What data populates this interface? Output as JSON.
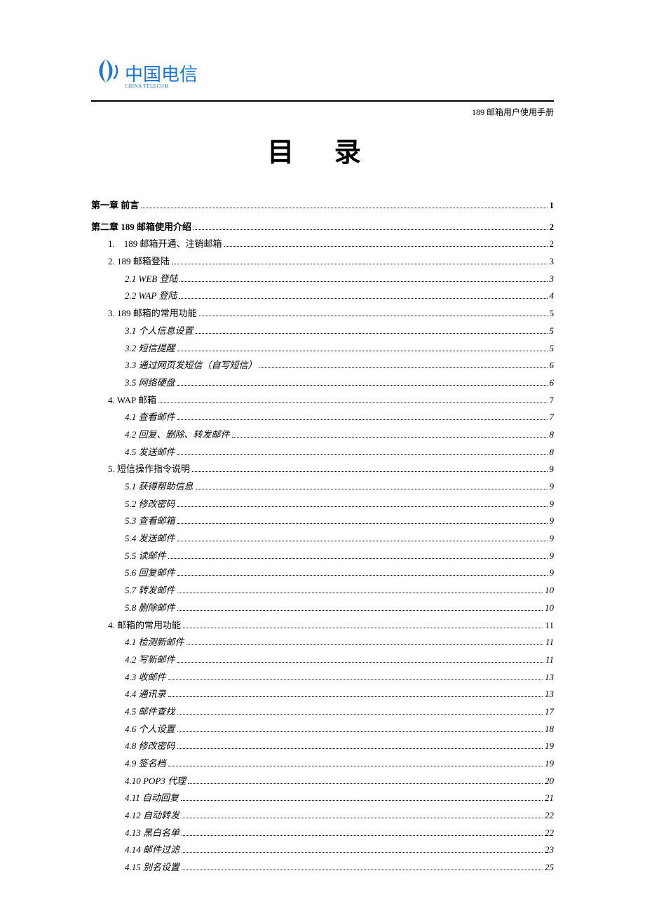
{
  "brand": {
    "name": "中国电信",
    "sub": "CHINA TELECOM"
  },
  "header_right": "189 邮箱用户使用手册",
  "title": "目  录",
  "toc": [
    {
      "level": 0,
      "label": "第一章  前言",
      "page": "1"
    },
    {
      "level": 0,
      "label": "第二章  189 邮箱使用介绍",
      "page": "2"
    },
    {
      "level": 1,
      "label": "1.　189 邮箱开通、注销邮箱",
      "page": "2"
    },
    {
      "level": 1,
      "label": "2. 189 邮箱登陆",
      "page": "3"
    },
    {
      "level": 2,
      "label": "2.1 WEB 登陆",
      "page": "3"
    },
    {
      "level": 2,
      "label": "2.2 WAP 登陆",
      "page": "4"
    },
    {
      "level": 1,
      "label": "3. 189 邮箱的常用功能",
      "page": "5"
    },
    {
      "level": 2,
      "label": "3.1 个人信息设置",
      "page": "5"
    },
    {
      "level": 2,
      "label": "3.2 短信提醒",
      "page": "5"
    },
    {
      "level": 2,
      "label": "3.3 通过网页发短信（自写短信）",
      "page": "6"
    },
    {
      "level": 2,
      "label": "3.5 网络硬盘",
      "page": "6"
    },
    {
      "level": 1,
      "label": "4. WAP 邮箱",
      "page": "7"
    },
    {
      "level": 2,
      "label": "4.1 查看邮件",
      "page": "7"
    },
    {
      "level": 2,
      "label": "4.2 回复、删除、转发邮件",
      "page": "8"
    },
    {
      "level": 2,
      "label": "4.5 发送邮件",
      "page": "8"
    },
    {
      "level": 1,
      "label": "5. 短信操作指令说明",
      "page": "9"
    },
    {
      "level": 2,
      "label": "5.1 获得帮助信息",
      "page": "9"
    },
    {
      "level": 2,
      "label": "5.2 修改密码",
      "page": "9"
    },
    {
      "level": 2,
      "label": "5.3 查看邮箱",
      "page": "9"
    },
    {
      "level": 2,
      "label": "5.4 发送邮件",
      "page": "9"
    },
    {
      "level": 2,
      "label": "5.5 读邮件",
      "page": "9"
    },
    {
      "level": 2,
      "label": "5.6 回复邮件",
      "page": "9"
    },
    {
      "level": 2,
      "label": "5.7 转发邮件",
      "page": "10"
    },
    {
      "level": 2,
      "label": "5.8 删除邮件",
      "page": "10"
    },
    {
      "level": 1,
      "label": "4. 邮箱的常用功能",
      "page": "11"
    },
    {
      "level": 2,
      "label": "4.1 检测新邮件",
      "page": "11"
    },
    {
      "level": 2,
      "label": "4.2 写新邮件",
      "page": "11"
    },
    {
      "level": 2,
      "label": "4.3 收邮件",
      "page": "13"
    },
    {
      "level": 2,
      "label": "4.4 通讯录",
      "page": "13"
    },
    {
      "level": 2,
      "label": "4.5 邮件查找",
      "page": "17"
    },
    {
      "level": 2,
      "label": "4.6 个人设置",
      "page": "18"
    },
    {
      "level": 2,
      "label": "4.8 修改密码",
      "page": "19"
    },
    {
      "level": 2,
      "label": "4.9 签名档",
      "page": "19"
    },
    {
      "level": 2,
      "label": "4.10 POP3 代理",
      "page": "20"
    },
    {
      "level": 2,
      "label": "4.11 自动回复",
      "page": "21"
    },
    {
      "level": 2,
      "label": "4.12 自动转发",
      "page": "22"
    },
    {
      "level": 2,
      "label": "4.13 黑白名单",
      "page": "22"
    },
    {
      "level": 2,
      "label": "4.14 邮件过滤",
      "page": "23"
    },
    {
      "level": 2,
      "label": "4.15 别名设置",
      "page": "25"
    }
  ]
}
